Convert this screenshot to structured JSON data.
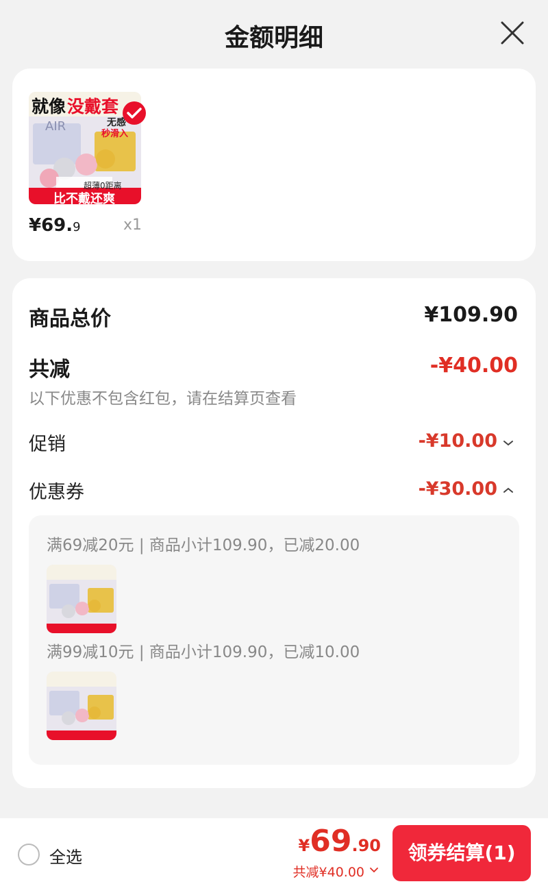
{
  "header": {
    "title": "金额明细"
  },
  "product": {
    "image_text_top_left": "就像",
    "image_text_top_red": "没戴套",
    "image_brand": "AIR",
    "image_badge_1": "无感",
    "image_badge_2": "秒滑入",
    "image_badge_3": "超薄0距离",
    "image_text_bottom": "比不戴还爽",
    "price_int": "¥69.",
    "price_dec": "9",
    "qty": "x1"
  },
  "detail": {
    "total_label": "商品总价",
    "total_value": "¥109.90",
    "discount_label": "共减",
    "discount_value": "-¥40.00",
    "hint": "以下优惠不包含红包，请在结算页查看",
    "promo_label": "促销",
    "promo_value": "-¥10.00",
    "coupon_label": "优惠券",
    "coupon_value": "-¥30.00",
    "coupons": [
      {
        "text": "满69减20元 | 商品小计109.90，已减20.00"
      },
      {
        "text": "满99减10元 | 商品小计109.90，已减10.00"
      }
    ]
  },
  "footer": {
    "select_all": "全选",
    "total_symbol": "¥",
    "total_int": "69",
    "total_dec": ".90",
    "saved": "共减¥40.00",
    "checkout": "领券结算(1)"
  },
  "colors": {
    "accent_red": "#e02e24",
    "button_red": "#f0283a",
    "background": "#f2f2f2"
  },
  "icons": [
    "close-icon",
    "checkmark-badge-icon",
    "chevron-down-icon",
    "chevron-up-icon",
    "radio-icon"
  ]
}
